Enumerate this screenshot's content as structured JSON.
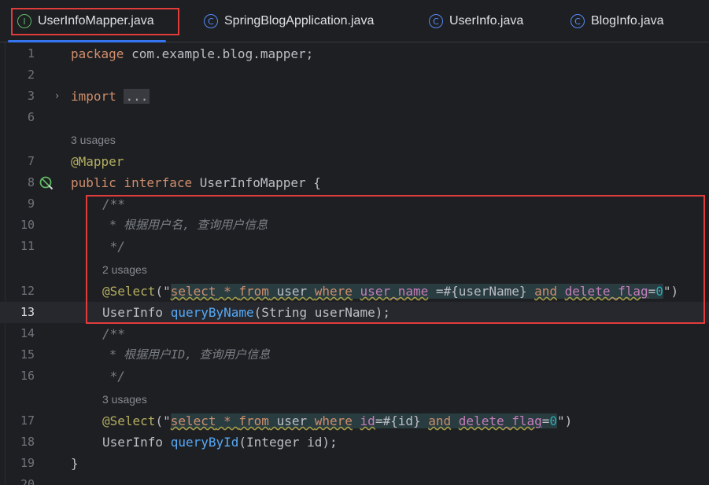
{
  "tabs": [
    {
      "label": "UserInfoMapper.java",
      "icon": "interface-icon",
      "icon_glyph": "I"
    },
    {
      "label": "SpringBlogApplication.java",
      "icon": "spring-class-icon",
      "icon_glyph": "C"
    },
    {
      "label": "UserInfo.java",
      "icon": "class-icon",
      "icon_glyph": "C"
    },
    {
      "label": "BlogInfo.java",
      "icon": "class-icon",
      "icon_glyph": "C"
    }
  ],
  "editor": {
    "current_line": "13",
    "colors": {
      "background": "#1e1f22",
      "keyword": "#cf8e6d",
      "annotation": "#b3ae60",
      "method": "#56a8f5",
      "string": "#6aab73",
      "field": "#c77dbb",
      "comment": "#7a7e85",
      "highlight_box": "#e03c3c"
    },
    "lines": {
      "l1": {
        "num": "1",
        "kw": "package",
        "rest": " com.example.blog.mapper;"
      },
      "l2": {
        "num": "2"
      },
      "l3": {
        "num": "3",
        "kw": "import",
        "fold": "..."
      },
      "l6": {
        "num": "6"
      },
      "hint1": {
        "text": "3 usages"
      },
      "l7": {
        "num": "7",
        "ann": "@Mapper"
      },
      "l8": {
        "num": "8",
        "kw": "public interface",
        "name": " UserInfoMapper {"
      },
      "l9": {
        "num": "9",
        "comment": "/**"
      },
      "l10": {
        "num": "10",
        "comment": " * 根据用户名, 查询用户信息"
      },
      "l11": {
        "num": "11",
        "comment": " */"
      },
      "hint2": {
        "text": "2 usages"
      },
      "l12": {
        "num": "12",
        "ann": "@Select",
        "open": "(\"",
        "sql_select": "select",
        "sql_star": " * ",
        "sql_from": "from",
        "sql_table": " user ",
        "sql_where": "where",
        "sql_sp1": " ",
        "sql_col1": "user_name",
        "sql_eq1": " =#{userName} ",
        "sql_and": "and",
        "sql_sp2": " ",
        "sql_col2": "delete_flag",
        "sql_eq2": "=",
        "sql_val": "0",
        "close": "\")"
      },
      "l13": {
        "num": "13",
        "type": "UserInfo ",
        "method": "queryByName",
        "params": "(String userName);"
      },
      "l14": {
        "num": "14",
        "comment": "/**"
      },
      "l15": {
        "num": "15",
        "comment": " * 根据用户ID, 查询用户信息"
      },
      "l16": {
        "num": "16",
        "comment": " */"
      },
      "hint3": {
        "text": "3 usages"
      },
      "l17": {
        "num": "17",
        "ann": "@Select",
        "open": "(\"",
        "sql_select": "select",
        "sql_star": " * ",
        "sql_from": "from",
        "sql_table": " user ",
        "sql_where": "where",
        "sql_sp1": " ",
        "sql_col1": "id",
        "sql_eq1": "=#{id} ",
        "sql_and": "and",
        "sql_sp2": " ",
        "sql_col2": "delete_flag",
        "sql_eq2": "=",
        "sql_val": "0",
        "close": "\")"
      },
      "l18": {
        "num": "18",
        "type": "UserInfo ",
        "method": "queryById",
        "params": "(Integer id);"
      },
      "l19": {
        "num": "19",
        "text": "}"
      },
      "l20": {
        "num": "20"
      }
    }
  }
}
